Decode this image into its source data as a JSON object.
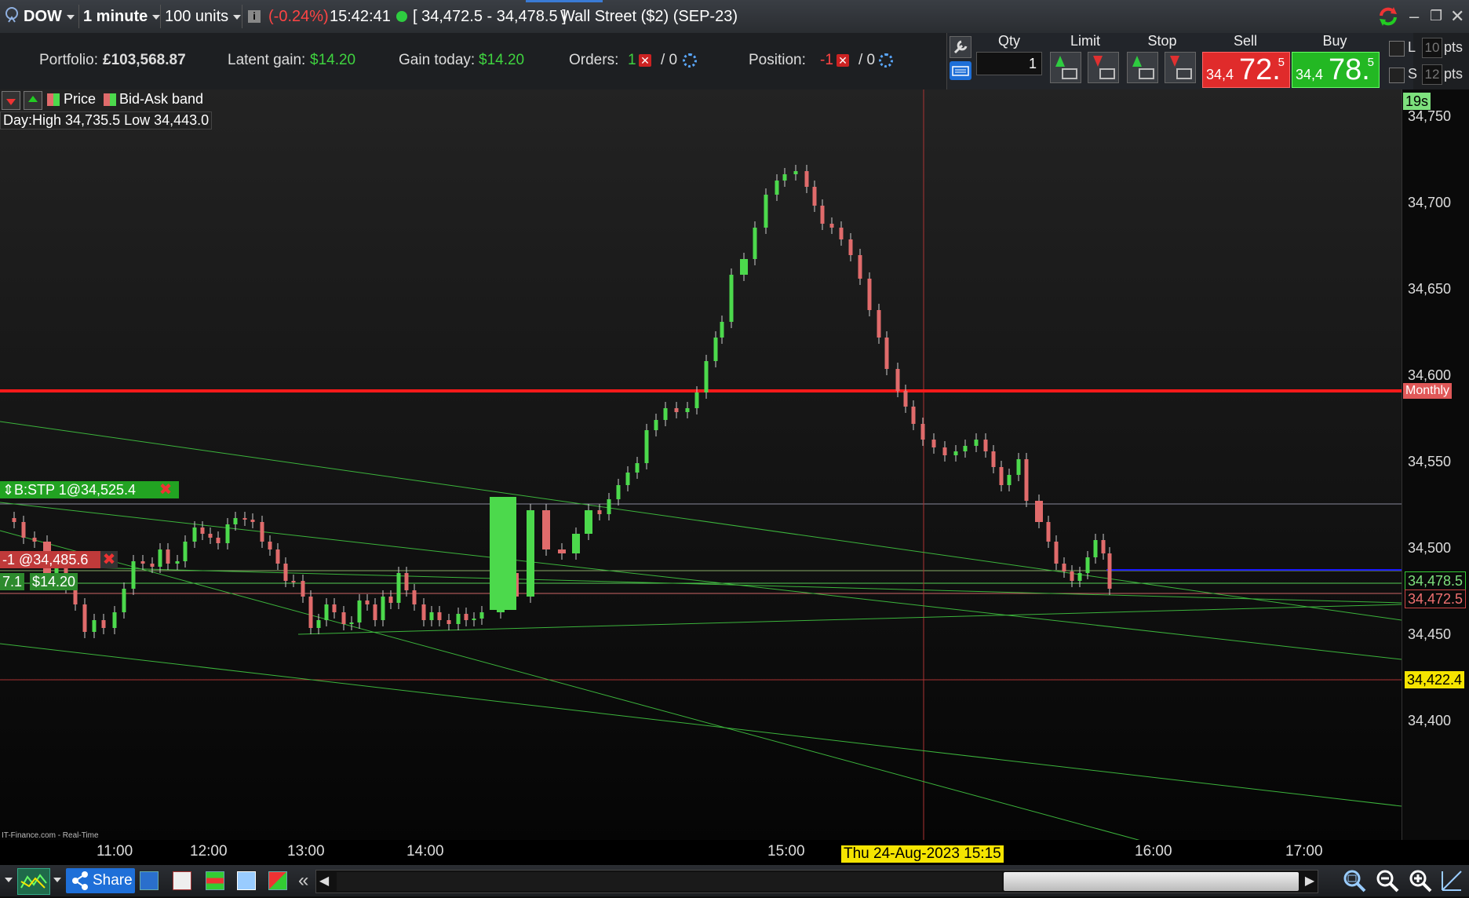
{
  "topbar": {
    "instrument": "DOW",
    "timeframe": "1 minute",
    "units": "100 units",
    "change_pct": "(-0.24%)",
    "time": "15:42:41",
    "spread_range": "[ 34,472.5 - 34,478.5 ]",
    "market_name": "Wall Street ($2) (SEP-23)"
  },
  "account": {
    "portfolio_label": "Portfolio:",
    "portfolio_value": "£103,568.87",
    "latent_label": "Latent gain:",
    "latent_value": "$14.20",
    "gain_today_label": "Gain today:",
    "gain_today_value": "$14.20",
    "orders_label": "Orders:",
    "orders_count": "1",
    "orders_sep": "/ 0",
    "position_label": "Position:",
    "position_count": "-1",
    "position_sep": "/ 0"
  },
  "trade_panel": {
    "qty_label": "Qty",
    "limit_label": "Limit",
    "stop_label": "Stop",
    "sell_label": "Sell",
    "buy_label": "Buy",
    "qty_value": "1",
    "sell_small": "34,4",
    "sell_big": "72.",
    "sell_sup": "5",
    "buy_small": "34,4",
    "buy_big": "78.",
    "buy_sup": "5",
    "l_label": "L",
    "l_value": "10",
    "s_label": "S",
    "s_value": "12",
    "pts_label": "pts"
  },
  "chart": {
    "legend_price": "Price",
    "legend_band": "Bid-Ask band",
    "day_range": "Day:High 34,735.5 Low 34,443.0",
    "timer": "19s",
    "monthly_tag": "Monthly",
    "stop_order_tag": "B:STP 1@34,525.4",
    "position_tag": "-1 @34,485.6",
    "position_qty": "7.1",
    "position_pl": "$14.20",
    "price_ask_tag": "34,478.5",
    "price_bid_tag": "34,472.5",
    "alert_tag": "34,422.4",
    "crosshair_date": "Thu 24-Aug-2023 15:15",
    "source": "IT-Finance.com - Real-Time",
    "y_ticks": [
      "34,750",
      "34,700",
      "34,650",
      "34,600",
      "34,550",
      "34,500",
      "34,450",
      "34,400"
    ],
    "x_ticks": [
      "11:00",
      "12:00",
      "13:00",
      "14:00",
      "15:00",
      "16:00",
      "17:00"
    ]
  },
  "bottombar": {
    "share_label": "Share"
  },
  "colors": {
    "up": "#4cd94c",
    "down": "#e06b6b",
    "monthly_line": "#ff1a1a",
    "trend_line": "#3cb43c",
    "bid_line": "#1a1aff"
  }
}
